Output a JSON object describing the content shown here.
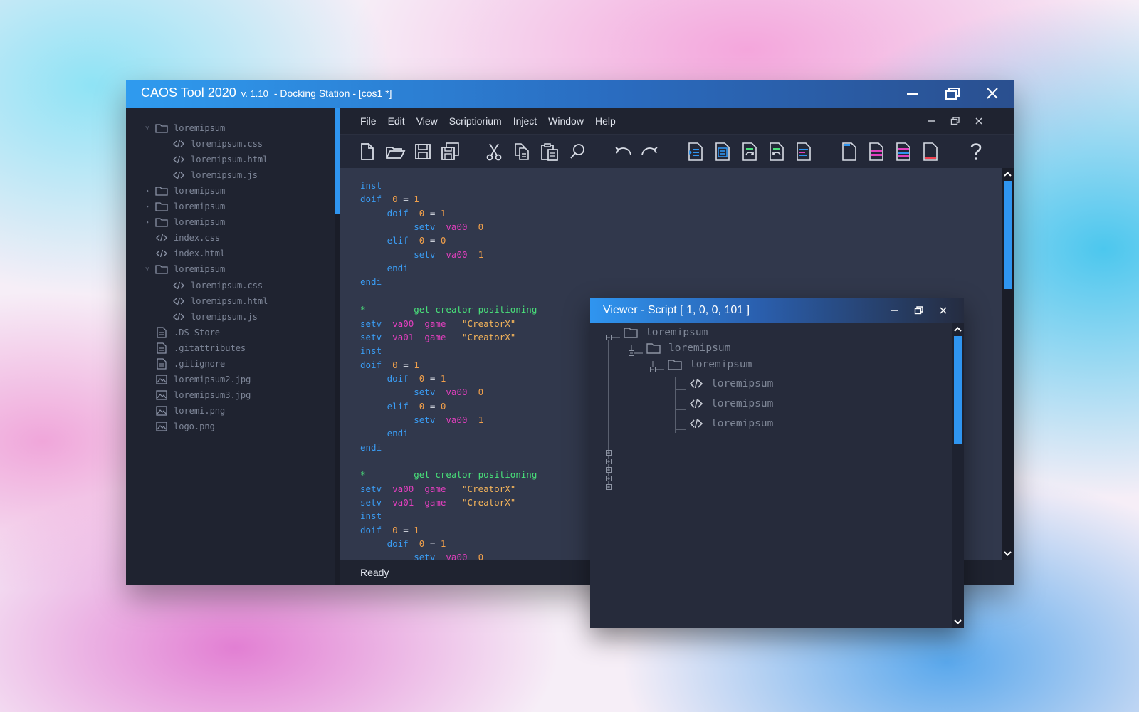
{
  "window": {
    "app_title": "CAOS Tool 2020",
    "version": "v. 1.10",
    "document": "- Docking Station - [cos1 *]"
  },
  "menu": [
    "File",
    "Edit",
    "View",
    "Scriptiorium",
    "Inject",
    "Window",
    "Help"
  ],
  "file_tree": [
    {
      "label": "loremipsum",
      "type": "folder",
      "expanded": true,
      "level": 0
    },
    {
      "label": "loremipsum.css",
      "type": "code",
      "level": 1
    },
    {
      "label": "loremipsum.html",
      "type": "code",
      "level": 1
    },
    {
      "label": "loremipsum.js",
      "type": "code",
      "level": 1
    },
    {
      "label": "loremipsum",
      "type": "folder",
      "expanded": false,
      "level": 0
    },
    {
      "label": "loremipsum",
      "type": "folder",
      "expanded": false,
      "level": 0
    },
    {
      "label": "loremipsum",
      "type": "folder",
      "expanded": false,
      "level": 0
    },
    {
      "label": "index.css",
      "type": "code",
      "level": 0
    },
    {
      "label": "index.html",
      "type": "code",
      "level": 0
    },
    {
      "label": "loremipsum",
      "type": "folder",
      "expanded": true,
      "level": 0
    },
    {
      "label": "loremipsum.css",
      "type": "code",
      "level": 1
    },
    {
      "label": "loremipsum.html",
      "type": "code",
      "level": 1
    },
    {
      "label": "loremipsum.js",
      "type": "code",
      "level": 1
    },
    {
      "label": ".DS_Store",
      "type": "file",
      "level": 0
    },
    {
      "label": ".gitattributes",
      "type": "file",
      "level": 0
    },
    {
      "label": ".gitignore",
      "type": "file",
      "level": 0
    },
    {
      "label": "loremipsum2.jpg",
      "type": "image",
      "level": 0
    },
    {
      "label": "loremipsum3.jpg",
      "type": "image",
      "level": 0
    },
    {
      "label": "loremi.png",
      "type": "image",
      "level": 0
    },
    {
      "label": "logo.png",
      "type": "image",
      "level": 0
    }
  ],
  "toolbar": {
    "buttons": [
      {
        "name": "new-file-icon"
      },
      {
        "name": "open-folder-icon"
      },
      {
        "name": "save-icon"
      },
      {
        "name": "save-all-icon"
      },
      {
        "name": "cut-icon"
      },
      {
        "name": "copy-icon"
      },
      {
        "name": "paste-icon"
      },
      {
        "name": "find-icon"
      },
      {
        "name": "undo-icon"
      },
      {
        "name": "redo-icon"
      },
      {
        "name": "script-run-icon"
      },
      {
        "name": "script-list-icon"
      },
      {
        "name": "script-refresh-icon"
      },
      {
        "name": "script-revert-icon"
      },
      {
        "name": "script-format-icon"
      },
      {
        "name": "doc-blue-icon"
      },
      {
        "name": "doc-pink-icon"
      },
      {
        "name": "doc-pink-blue-icon"
      },
      {
        "name": "doc-red-icon"
      },
      {
        "name": "help-icon"
      }
    ]
  },
  "code": [
    [
      {
        "t": "inst",
        "c": "kw"
      }
    ],
    [
      {
        "t": "doif",
        "c": "kw"
      },
      {
        "t": "  0",
        "c": "num"
      },
      {
        "t": " = ",
        "c": "op"
      },
      {
        "t": "1",
        "c": "num"
      }
    ],
    [
      {
        "t": "     doif",
        "c": "kw"
      },
      {
        "t": "  0",
        "c": "num"
      },
      {
        "t": " = ",
        "c": "op"
      },
      {
        "t": "1",
        "c": "num"
      }
    ],
    [
      {
        "t": "          setv",
        "c": "kw"
      },
      {
        "t": "  va00",
        "c": "var"
      },
      {
        "t": "  0",
        "c": "num"
      }
    ],
    [
      {
        "t": "     elif",
        "c": "kw"
      },
      {
        "t": "  0",
        "c": "num"
      },
      {
        "t": " = ",
        "c": "op"
      },
      {
        "t": "0",
        "c": "num"
      }
    ],
    [
      {
        "t": "          setv",
        "c": "kw"
      },
      {
        "t": "  va00",
        "c": "var"
      },
      {
        "t": "  1",
        "c": "num"
      }
    ],
    [
      {
        "t": "     endi",
        "c": "kw"
      }
    ],
    [
      {
        "t": "endi",
        "c": "kw"
      }
    ],
    [],
    [
      {
        "t": "*",
        "c": "cm"
      },
      {
        "t": "         get creator positioning",
        "c": "cm"
      }
    ],
    [
      {
        "t": "setv",
        "c": "kw"
      },
      {
        "t": "  va00",
        "c": "var"
      },
      {
        "t": "  game",
        "c": "var"
      },
      {
        "t": "   \"CreatorX\"",
        "c": "str"
      }
    ],
    [
      {
        "t": "setv",
        "c": "kw"
      },
      {
        "t": "  va01",
        "c": "var"
      },
      {
        "t": "  game",
        "c": "var"
      },
      {
        "t": "   \"CreatorX\"",
        "c": "str"
      }
    ],
    [
      {
        "t": "inst",
        "c": "kw"
      }
    ],
    [
      {
        "t": "doif",
        "c": "kw"
      },
      {
        "t": "  0",
        "c": "num"
      },
      {
        "t": " = ",
        "c": "op"
      },
      {
        "t": "1",
        "c": "num"
      }
    ],
    [
      {
        "t": "     doif",
        "c": "kw"
      },
      {
        "t": "  0",
        "c": "num"
      },
      {
        "t": " = ",
        "c": "op"
      },
      {
        "t": "1",
        "c": "num"
      }
    ],
    [
      {
        "t": "          setv",
        "c": "kw"
      },
      {
        "t": "  va00",
        "c": "var"
      },
      {
        "t": "  0",
        "c": "num"
      }
    ],
    [
      {
        "t": "     elif",
        "c": "kw"
      },
      {
        "t": "  0",
        "c": "num"
      },
      {
        "t": " = ",
        "c": "op"
      },
      {
        "t": "0",
        "c": "num"
      }
    ],
    [
      {
        "t": "          setv",
        "c": "kw"
      },
      {
        "t": "  va00",
        "c": "var"
      },
      {
        "t": "  1",
        "c": "num"
      }
    ],
    [
      {
        "t": "     endi",
        "c": "kw"
      }
    ],
    [
      {
        "t": "endi",
        "c": "kw"
      }
    ],
    [],
    [
      {
        "t": "*",
        "c": "cm"
      },
      {
        "t": "         get creator positioning",
        "c": "cm"
      }
    ],
    [
      {
        "t": "setv",
        "c": "kw"
      },
      {
        "t": "  va00",
        "c": "var"
      },
      {
        "t": "  game",
        "c": "var"
      },
      {
        "t": "   \"CreatorX\"",
        "c": "str"
      }
    ],
    [
      {
        "t": "setv",
        "c": "kw"
      },
      {
        "t": "  va01",
        "c": "var"
      },
      {
        "t": "  game",
        "c": "var"
      },
      {
        "t": "   \"CreatorX\"",
        "c": "str"
      }
    ],
    [
      {
        "t": "inst",
        "c": "kw"
      }
    ],
    [
      {
        "t": "doif",
        "c": "kw"
      },
      {
        "t": "  0",
        "c": "num"
      },
      {
        "t": " = ",
        "c": "op"
      },
      {
        "t": "1",
        "c": "num"
      }
    ],
    [
      {
        "t": "     doif",
        "c": "kw"
      },
      {
        "t": "  0",
        "c": "num"
      },
      {
        "t": " = ",
        "c": "op"
      },
      {
        "t": "1",
        "c": "num"
      }
    ],
    [
      {
        "t": "          setv",
        "c": "kw"
      },
      {
        "t": "  va00",
        "c": "var"
      },
      {
        "t": "  0",
        "c": "num"
      }
    ]
  ],
  "status": "Ready",
  "viewer": {
    "title": "Viewer - Script [ 1, 0, 0, 101 ]",
    "nodes": [
      {
        "label": "loremipsum",
        "type": "folder",
        "level": 0
      },
      {
        "label": "loremipsum",
        "type": "folder",
        "level": 1
      },
      {
        "label": "loremipsum",
        "type": "folder",
        "level": 2
      },
      {
        "label": "loremipsum",
        "type": "code",
        "level": 3
      },
      {
        "label": "loremipsum",
        "type": "code",
        "level": 3
      },
      {
        "label": "loremipsum",
        "type": "code",
        "level": 3
      }
    ]
  },
  "colors": {
    "accent": "#2f95f0",
    "keyword": "#3a9cf3",
    "variable": "#e23fbe",
    "number": "#f1a04b",
    "string": "#f3b35a",
    "comment": "#49e07a",
    "operator": "#c9cdd6"
  }
}
